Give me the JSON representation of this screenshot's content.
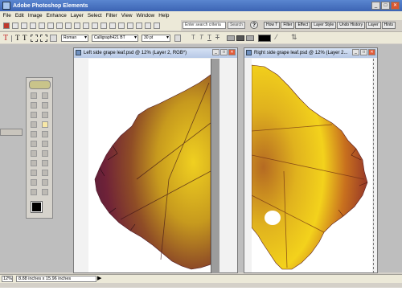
{
  "app": {
    "title": "Adobe Photoshop Elements"
  },
  "window_buttons": {
    "minimize": "_",
    "maximize": "□",
    "close": "✕"
  },
  "menu": [
    "File",
    "Edit",
    "Image",
    "Enhance",
    "Layer",
    "Select",
    "Filter",
    "View",
    "Window",
    "Help"
  ],
  "search": {
    "placeholder": "Enter search criteria",
    "button": "Search"
  },
  "help_icon": "?",
  "palette_tabs": [
    "How T",
    "Filter",
    "Effect",
    "Layer Style",
    "Undo History",
    "Layer",
    "Hints"
  ],
  "options": {
    "font_family": "Roman",
    "font_name": "Calligraph421 BT",
    "font_size": "30 pt",
    "color_swatch": "#000000"
  },
  "left_doc": {
    "title": "Left side grape leaf.psd @ 12% (Layer 2, RGB*)"
  },
  "right_doc": {
    "title": "Right side grape leaf.psd @ 12% (Layer 2..."
  },
  "status": {
    "zoom": "12%",
    "doc_size": "8.88 inches x 15.96 inches",
    "arrow": "▶"
  },
  "colors": {
    "title_bar": "#3c64b4",
    "chrome": "#ece9d8",
    "workspace": "#bebebe"
  }
}
